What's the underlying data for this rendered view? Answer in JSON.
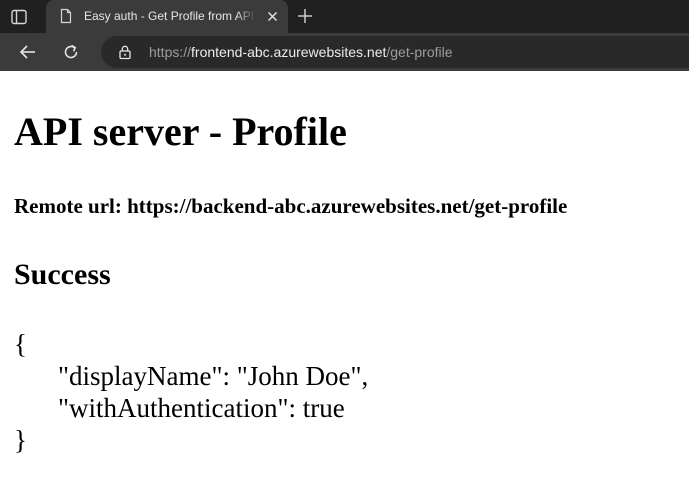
{
  "browser": {
    "tab": {
      "title": "Easy auth - Get Profile from API server",
      "favicon": "document-icon"
    },
    "address": {
      "scheme": "https://",
      "host": "frontend-abc.azurewebsites.net",
      "path": "/get-profile"
    },
    "colors": {
      "tabstrip": "#202020",
      "toolbar": "#3b3b3b",
      "omnibox": "#292929"
    }
  },
  "page": {
    "title": "API server - Profile",
    "remote_url": "Remote url: https://backend-abc.azurewebsites.net/get-profile",
    "status": "Success",
    "json": {
      "open": "{",
      "line1": "\"displayName\": \"John Doe\",",
      "line2": "\"withAuthentication\": true",
      "close": "}"
    }
  }
}
